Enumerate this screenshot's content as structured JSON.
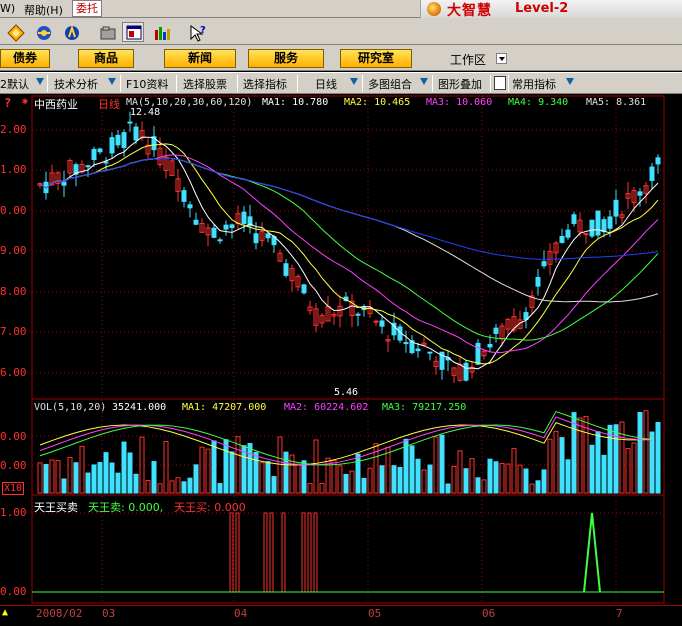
{
  "menu": {
    "items": [
      "W)",
      "帮助(H)",
      "委托"
    ]
  },
  "brand": {
    "name": "大智慧",
    "edition": "Level-2"
  },
  "nav": {
    "buttons": [
      "债券",
      "商品",
      "新闻",
      "服务",
      "研究室"
    ],
    "workarea": "工作区"
  },
  "func": {
    "items": [
      "2默认",
      "技术分析",
      "F10资料",
      "选择股票",
      "选择指标",
      "日线",
      "多图组合",
      "图形叠加",
      "常用指标"
    ]
  },
  "stock": {
    "name": "中西药业",
    "period": "日线",
    "ma_label": "MA(5,10,20,30,60,120)",
    "ma1": "MA1: 10.780",
    "ma2": "MA2: 10.465",
    "ma3": "MA3: 10.060",
    "ma4": "MA4: 9.340",
    "ma5": "MA5: 8.361",
    "high_mark": "12.48",
    "low_mark": "5.46",
    "y_labels": [
      "2.00",
      "1.00",
      "0.00",
      "9.00",
      "8.00",
      "7.00",
      "6.00"
    ]
  },
  "volume": {
    "label": "VOL(5,10,20)",
    "val": "35241.000",
    "ma1": "MA1: 47207.000",
    "ma2": "MA2: 60224.602",
    "ma3": "MA3: 79217.250",
    "y_labels": [
      "0.00",
      "0.00"
    ],
    "unit": "X10"
  },
  "indicator": {
    "name": "天王买卖",
    "sell": "天王卖: 0.000,",
    "buy": "天王买: 0.000",
    "y_labels": [
      "1.00",
      "0.00"
    ]
  },
  "x_labels": [
    "2008/02",
    "03",
    "04",
    "05",
    "06",
    "7"
  ],
  "colors": {
    "up": "#ff3030",
    "down": "#40e0ff",
    "ma1": "#ffffff",
    "ma2": "#ffff40",
    "ma3": "#ff40ff",
    "ma4": "#40ff40",
    "ma5": "#e0e0e0",
    "ma6": "#2040ff",
    "grid": "#a00000"
  },
  "icons": [
    "diamond-icon",
    "zoom-icon",
    "f10-icon",
    "folder-icon",
    "window-icon",
    "bars-icon",
    "help-cursor-icon"
  ]
}
